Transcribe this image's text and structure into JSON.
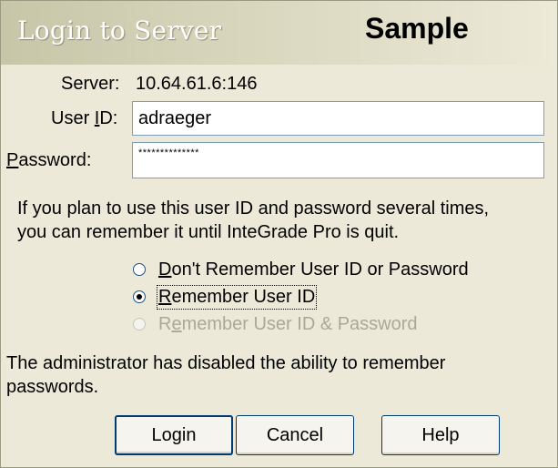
{
  "title": "Login to Server",
  "watermark": "Sample",
  "server": {
    "label": "Server:",
    "value": "10.64.61.6:146"
  },
  "user_id": {
    "label_pre": "User ",
    "label_key": "I",
    "label_post": "D:",
    "value": "adraeger"
  },
  "password": {
    "label_key": "P",
    "label_post": "assword:",
    "value": "**************"
  },
  "info_line1": "If you plan to use this user ID and password several times,",
  "info_line2": "you can remember it until InteGrade Pro is quit.",
  "radios": [
    {
      "key": "D",
      "rest": "on't Remember User ID or Password",
      "checked": false,
      "enabled": true
    },
    {
      "key": "R",
      "rest": "emember User ID",
      "checked": true,
      "enabled": true
    },
    {
      "pre": "R",
      "key": "e",
      "rest": "member User ID & Password",
      "checked": false,
      "enabled": false
    }
  ],
  "admin_line1": "The administrator has disabled the ability to remember",
  "admin_line2": "passwords.",
  "buttons": {
    "login": "Login",
    "cancel": "Cancel",
    "help": "Help"
  },
  "colors": {
    "dialog_bg": "#ece9d8",
    "titlebar_start": "#c8c6a8",
    "titlebar_end": "#ecead8",
    "button_border": "#003c74"
  }
}
